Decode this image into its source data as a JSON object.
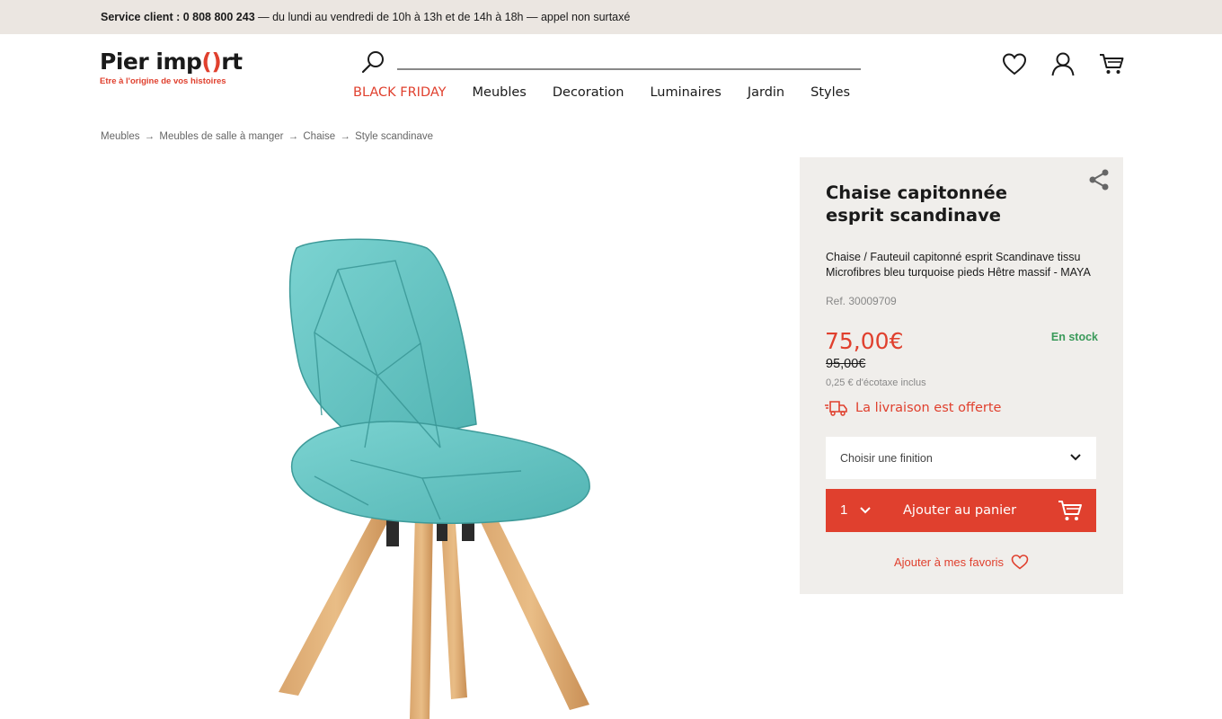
{
  "topbar": {
    "label": "Service client : 0 808 800 243",
    "hours": " — du lundi au vendredi de 10h à 13h et de 14h à 18h — appel non surtaxé"
  },
  "logo": {
    "part1": "Pier imp",
    "part2": "()",
    "part3": "rt",
    "tagline": "Etre à l'origine de vos histoires"
  },
  "search": {
    "icon": "search-icon",
    "value": "",
    "placeholder": ""
  },
  "nav": {
    "items": [
      {
        "label": "BLACK FRIDAY"
      },
      {
        "label": "Meubles"
      },
      {
        "label": "Decoration"
      },
      {
        "label": "Luminaires"
      },
      {
        "label": "Jardin"
      },
      {
        "label": "Styles"
      }
    ]
  },
  "header_icons": [
    "heart-icon",
    "user-icon",
    "cart-icon"
  ],
  "breadcrumb": {
    "items": [
      "Meubles",
      "Meubles de salle à manger",
      "Chaise",
      "Style scandinave"
    ],
    "separator": "→"
  },
  "product": {
    "title": "Chaise capitonnée esprit scandinave",
    "description": "Chaise / Fauteuil capitonné esprit Scandinave tissu Microfibres bleu turquoise pieds Hêtre massif - MAYA",
    "ref": "Ref. 30009709",
    "price": "75,00€",
    "old_price": "95,00€",
    "stock": "En stock",
    "ecotax": "0,25 € d'écotaxe inclus",
    "delivery": "La livraison est offerte",
    "finish_select": "Choisir une finition",
    "quantity": "1",
    "add_to_cart": "Ajouter au panier",
    "add_to_favorites": "Ajouter à mes favoris",
    "image_alt": "turquoise-chair-image"
  },
  "colors": {
    "accent": "#e0402e",
    "topbar_bg": "#ebe6e1",
    "panel_bg": "#f0eeeb",
    "stock": "#3a9a5a",
    "chair_fabric": "#6fc8c6"
  }
}
